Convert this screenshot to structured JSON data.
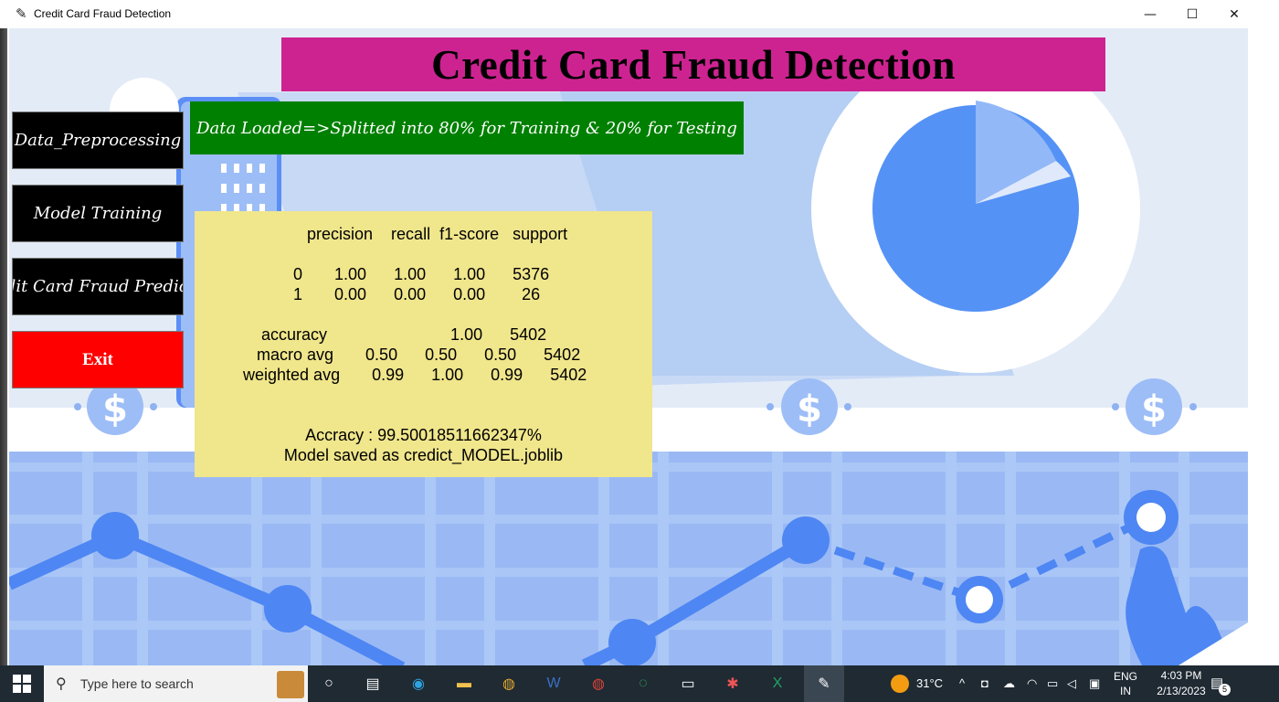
{
  "window": {
    "title": "Credit Card Fraud Detection",
    "minimize": "—",
    "maximize": "☐",
    "close": "✕"
  },
  "banner": {
    "title": "Credit Card Fraud Detection"
  },
  "status": {
    "text": "Data Loaded=>Splitted into 80% for Training & 20% for Testing"
  },
  "sidebar": {
    "preprocess": "Data_Preprocessing",
    "training": "Model Training",
    "predict": "Credit Card Fraud Prediction",
    "exit": "Exit"
  },
  "report": {
    "body": "              precision    recall  f1-score   support\n\n           0       1.00      1.00      1.00      5376\n           1       0.00      0.00      0.00        26\n\n    accuracy                           1.00      5402\n   macro avg       0.50      0.50      0.50      5402\nweighted avg       0.99      1.00      0.99      5402",
    "accuracy": "Accracy : 99.50018511662347%",
    "saved": "Model saved as credict_MODEL.joblib"
  },
  "taskbar": {
    "search_placeholder": "Type here to search",
    "weather": "31°C",
    "lang": "ENG",
    "region": "IN",
    "time": "4:03 PM",
    "date": "2/13/2023",
    "notifications": "5"
  }
}
